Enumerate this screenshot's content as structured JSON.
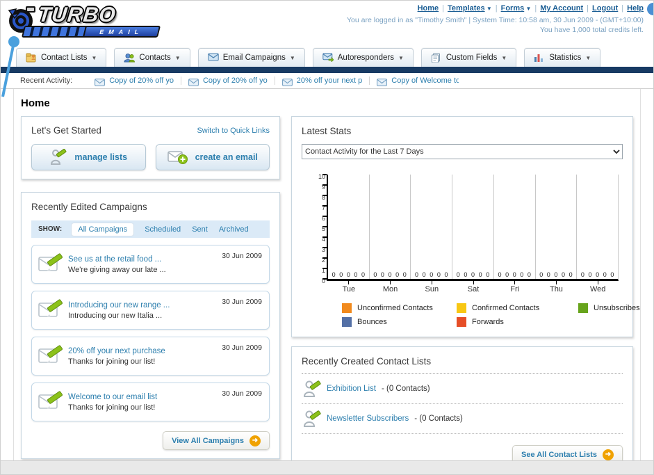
{
  "logo": {
    "title": "TURBO",
    "subtitle": "EMAIL"
  },
  "header": {
    "nav_links": [
      {
        "label": "Home",
        "dropdown": false
      },
      {
        "label": "Templates",
        "dropdown": true
      },
      {
        "label": "Forms",
        "dropdown": true
      },
      {
        "label": "My Account",
        "dropdown": false
      },
      {
        "label": "Logout",
        "dropdown": false
      },
      {
        "label": "Help",
        "dropdown": false
      }
    ],
    "login_info": "You are logged in as \"Timothy Smith\" | System Time: 10:58 am, 30 Jun 2009 - (GMT+10:00)",
    "credits_info": "You have 1,000 total credits left."
  },
  "tabs": [
    {
      "label": "Contact Lists",
      "icon": "contact-lists"
    },
    {
      "label": "Contacts",
      "icon": "contacts"
    },
    {
      "label": "Email Campaigns",
      "icon": "email-campaigns"
    },
    {
      "label": "Autoresponders",
      "icon": "autoresponders"
    },
    {
      "label": "Custom Fields",
      "icon": "custom-fields"
    },
    {
      "label": "Statistics",
      "icon": "statistics"
    }
  ],
  "recent_activity": {
    "label": "Recent Activity:",
    "items": [
      "Copy of 20% off yo",
      "Copy of 20% off yo",
      "20% off your next p",
      "Copy of Welcome to"
    ]
  },
  "page_title": "Home",
  "get_started": {
    "title": "Let's Get Started",
    "switch_link": "Switch to Quick Links",
    "manage_label": "manage lists",
    "create_label": "create an email"
  },
  "campaigns": {
    "title": "Recently Edited Campaigns",
    "show_label": "SHOW:",
    "filters": [
      "All Campaigns",
      "Scheduled",
      "Sent",
      "Archived"
    ],
    "active_filter": "All Campaigns",
    "items": [
      {
        "title": "See us at the retail food ...",
        "subtitle": "We're giving away our late ...",
        "date": "30 Jun 2009"
      },
      {
        "title": "Introducing our new range ...",
        "subtitle": "Introducing our new Italia ...",
        "date": "30 Jun 2009"
      },
      {
        "title": "20% off your next purchase",
        "subtitle": "Thanks for joining our list!",
        "date": "30 Jun 2009"
      },
      {
        "title": "Welcome to our email list",
        "subtitle": "Thanks for joining our list!",
        "date": "30 Jun 2009"
      }
    ],
    "view_all_label": "View All Campaigns"
  },
  "stats": {
    "title": "Latest Stats",
    "dropdown_value": "Contact Activity for the Last 7 Days",
    "chart_data": {
      "type": "bar",
      "title": "Contact Activity for the Last 7 Days",
      "categories": [
        "Tue",
        "Mon",
        "Sun",
        "Sat",
        "Fri",
        "Thu",
        "Wed"
      ],
      "series": [
        {
          "name": "Unconfirmed Contacts",
          "color": "#f18a1d",
          "values": [
            0,
            0,
            0,
            0,
            0,
            0,
            0
          ]
        },
        {
          "name": "Confirmed Contacts",
          "color": "#f8c713",
          "values": [
            0,
            0,
            0,
            0,
            0,
            0,
            0
          ]
        },
        {
          "name": "Unsubscribes",
          "color": "#67a41c",
          "values": [
            0,
            0,
            0,
            0,
            0,
            0,
            0
          ]
        },
        {
          "name": "Bounces",
          "color": "#5470a6",
          "values": [
            0,
            0,
            0,
            0,
            0,
            0,
            0
          ]
        },
        {
          "name": "Forwards",
          "color": "#e64e27",
          "values": [
            0,
            0,
            0,
            0,
            0,
            0,
            0
          ]
        }
      ],
      "ylim": [
        0,
        10
      ],
      "yticks": [
        0,
        1,
        2,
        3,
        4,
        5,
        6,
        7,
        8,
        9,
        10
      ],
      "grid": "vertical",
      "legend_position": "bottom"
    },
    "legend": [
      {
        "label": "Unconfirmed Contacts",
        "color": "#f18a1d"
      },
      {
        "label": "Confirmed Contacts",
        "color": "#f8c713"
      },
      {
        "label": "Unsubscribes",
        "color": "#67a41c"
      },
      {
        "label": "Bounces",
        "color": "#5470a6"
      },
      {
        "label": "Forwards",
        "color": "#e64e27"
      }
    ]
  },
  "contact_lists": {
    "title": "Recently Created Contact Lists",
    "items": [
      {
        "name": "Exhibition List",
        "detail": "- (0 Contacts)"
      },
      {
        "name": "Newsletter Subscribers",
        "detail": "- (0 Contacts)"
      }
    ],
    "see_all_label": "See All Contact Lists"
  }
}
